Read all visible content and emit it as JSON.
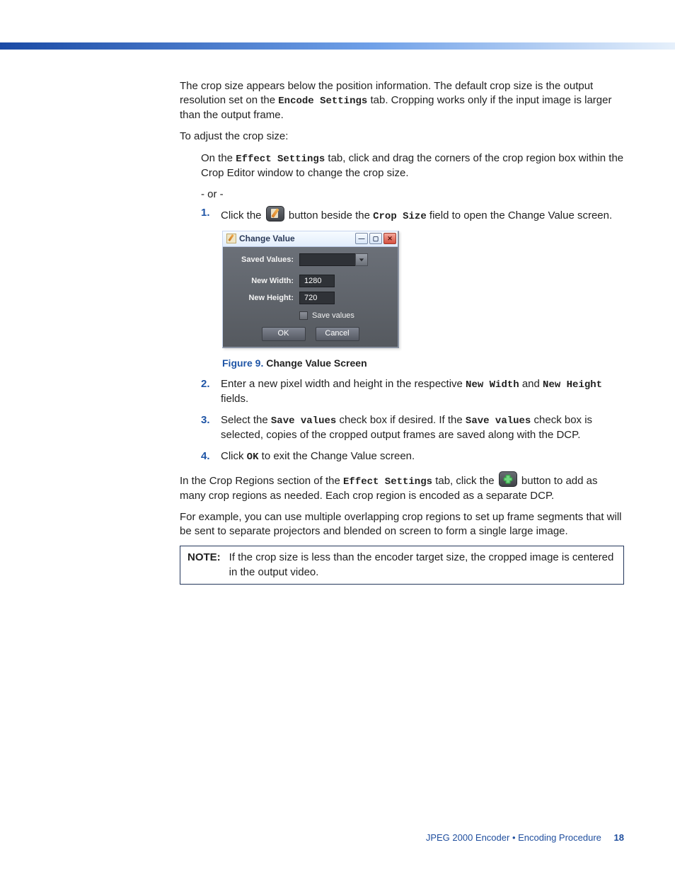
{
  "intro": {
    "p1a": "The crop size appears below the position information. The default crop size is the output resolution set on the ",
    "p1code": "Encode Settings",
    "p1b": " tab. Cropping works only if the input image is larger than the output frame.",
    "p2": "To adjust the crop size:",
    "p3a": "On the ",
    "p3code": "Effect Settings",
    "p3b": " tab, click and drag the corners of the crop region box within the Crop Editor window to change the crop size.",
    "or": "- or -"
  },
  "steps": {
    "s1num": "1.",
    "s1a": "Click the ",
    "s1b": " button beside the ",
    "s1code": "Crop Size",
    "s1c": " field to open the Change Value screen.",
    "s2num": "2.",
    "s2a": "Enter a new pixel width and height in the respective ",
    "s2code1": "New Width",
    "s2and": " and ",
    "s2code2": "New Height",
    "s2b": " fields.",
    "s3num": "3.",
    "s3a": "Select the ",
    "s3code1": "Save values",
    "s3b": " check box if desired. If the ",
    "s3code2": "Save values",
    "s3c": " check box is selected, copies of the cropped output frames are saved along with the DCP.",
    "s4num": "4.",
    "s4a": "Click ",
    "s4code": "OK",
    "s4b": " to exit the Change Value screen."
  },
  "dialog": {
    "title": "Change Value",
    "saved_values_label": "Saved Values:",
    "new_width_label": "New Width:",
    "new_width_value": "1280",
    "new_height_label": "New Height:",
    "new_height_value": "720",
    "save_values_label": "Save values",
    "ok": "OK",
    "cancel": "Cancel",
    "min_glyph": "—",
    "max_glyph": "▢",
    "close_glyph": "✕"
  },
  "caption": {
    "fig": "Figure 9. ",
    "text": "Change Value Screen"
  },
  "after": {
    "p1a": "In the Crop Regions section of the ",
    "p1code": "Effect Settings",
    "p1b": " tab, click the ",
    "p1c": " button to add as many crop regions as needed. Each crop region is encoded as a separate DCP.",
    "p2": "For example, you can use multiple overlapping crop regions to set up frame segments that will be sent to separate projectors and blended on screen to form a single large image."
  },
  "note": {
    "label": "NOTE:",
    "text": "If the crop size is less than the encoder target size, the cropped image is centered in the output video."
  },
  "footer": {
    "text": "JPEG 2000 Encoder • Encoding Procedure",
    "page": "18"
  }
}
